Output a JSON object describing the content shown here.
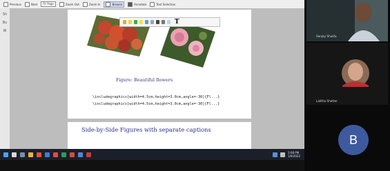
{
  "toolbar": {
    "items": [
      "Previous",
      "Next",
      "Fit Page",
      "Zoom Out",
      "Zoom In",
      "Browse",
      "Annotate",
      "Text Selection"
    ],
    "zoom_value": "Fit Page"
  },
  "left_strip": [
    "Sh",
    "Bu",
    "W"
  ],
  "slide": {
    "caption": "Figure: Beautiful flowers",
    "code_line_1": "\\includegraphics[width=4.5cm,height=3.0cm,angle=-30]{Fl...}",
    "code_line_2": "\\includegraphics[width=4.5cm,height=3.0cm,angle=-30]{Fl...}"
  },
  "slide2": {
    "heading": "Side-by-Side Figures with separate captions"
  },
  "participants": {
    "p1_name": "Sanjay Shukla",
    "p2_name": "Lalitha Shetter",
    "p3_initial": "B"
  },
  "taskbar": {
    "time": "3:08 PM",
    "date": "1/9/2022"
  },
  "colors": {
    "slide_heading": "#2d2d8a",
    "avatar_b": "#3d5a9e",
    "taskbar": "#1b1f2a"
  }
}
